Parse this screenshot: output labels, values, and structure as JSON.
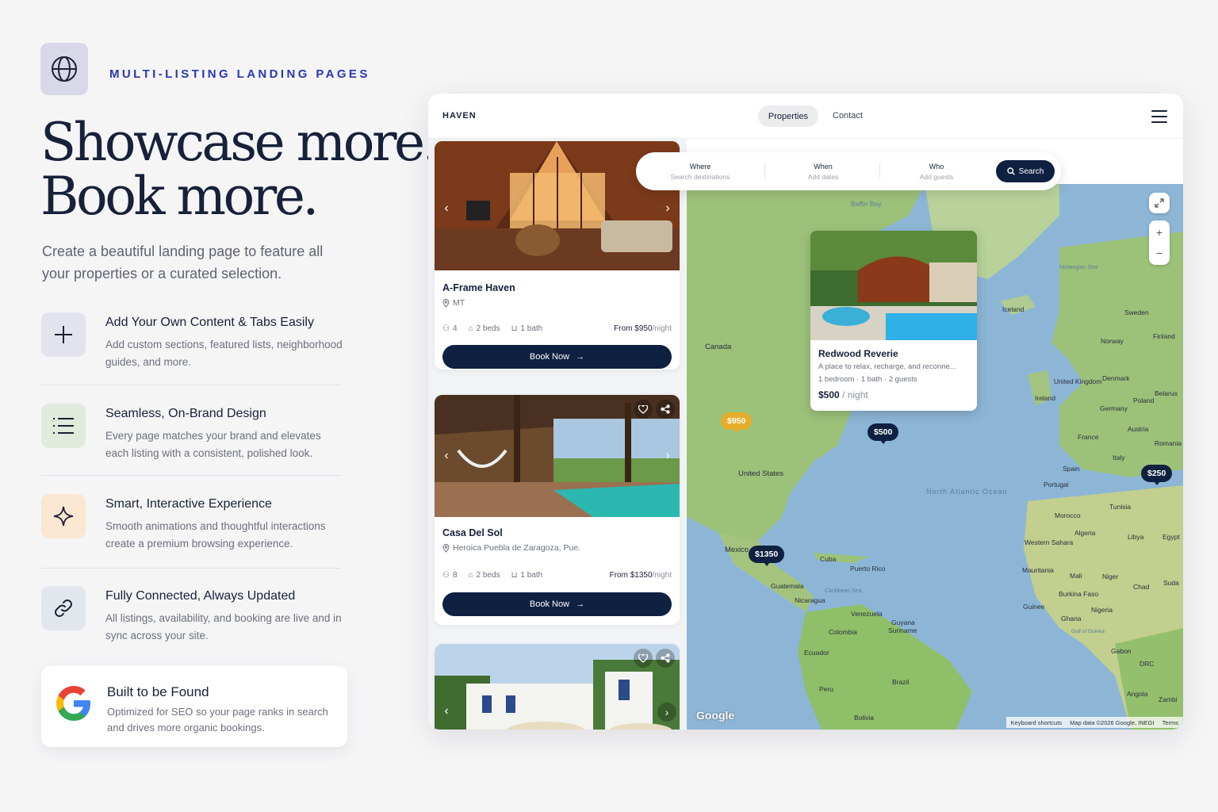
{
  "eyebrow": "MULTI-LISTING LANDING PAGES",
  "headline": {
    "line1": "Showcase more.",
    "line2": "Book more."
  },
  "subhead": "Create a beautiful landing page to feature all your properties or a curated selection.",
  "features": [
    {
      "title": "Add Your Own Content & Tabs Easily",
      "desc": "Add custom sections, featured lists, neighborhood guides, and more.",
      "icon": "plus-icon",
      "color": "#e3e3ee"
    },
    {
      "title": "Seamless, On-Brand Design",
      "desc": "Every page matches your brand and elevates each listing with a consistent, polished look.",
      "icon": "list-icon",
      "color": "#e2e9dd"
    },
    {
      "title": "Smart, Interactive Experience",
      "desc": "Smooth animations and thoughtful interactions create a premium browsing experience.",
      "icon": "sparkle-icon",
      "color": "#fbe7d2"
    },
    {
      "title": "Fully Connected, Always Updated",
      "desc": "All listings, availability, and booking are live and in sync across your site.",
      "icon": "link-icon",
      "color": "#e2e7ee"
    }
  ],
  "found": {
    "title": "Built to be Found",
    "desc": "Optimized for SEO so your page ranks in search and drives more organic bookings."
  },
  "app": {
    "brand": "HAVEN",
    "nav": {
      "properties": "Properties",
      "contact": "Contact"
    },
    "search": {
      "where_label": "Where",
      "where_placeholder": "Search destinations",
      "when_label": "When",
      "when_placeholder": "Add dates",
      "who_label": "Who",
      "who_placeholder": "Add guests",
      "button": "Search"
    },
    "listings": [
      {
        "title": "A-Frame Haven",
        "location": "MT",
        "guests": "4",
        "beds": "2 beds",
        "baths": "1 bath",
        "price": "From $950",
        "per": "/night",
        "cta": "Book Now"
      },
      {
        "title": "Casa Del Sol",
        "location": "Heroica Puebla de Zaragoza, Pue.",
        "guests": "8",
        "beds": "2 beds",
        "baths": "1 bath",
        "price": "From $1350",
        "per": "/night",
        "cta": "Book Now"
      }
    ],
    "map": {
      "popup": {
        "title": "Redwood Reverie",
        "desc": "A place to relax, recharge, and reconne...",
        "specs": "1 bedroom · 1 bath · 2 guests",
        "price": "$500",
        "per": " / night"
      },
      "pins": [
        "$950",
        "$500",
        "$1350",
        "$250"
      ],
      "labels": {
        "canada": "Canada",
        "us": "United States",
        "mexico": "Mexico",
        "cuba": "Cuba",
        "pr": "Puerto Rico",
        "guatemala": "Guatemala",
        "nicaragua": "Nicaragua",
        "venezuela": "Venezuela",
        "guyana": "Guyana",
        "suriname": "Suriname",
        "colombia": "Colombia",
        "ecuador": "Ecuador",
        "peru": "Peru",
        "brazil": "Brazil",
        "bolivia": "Bolivia",
        "iceland": "Iceland",
        "ireland": "Ireland",
        "uk": "United Kingdom",
        "sweden": "Sweden",
        "norway": "Norway",
        "finland": "Finland",
        "denmark": "Denmark",
        "belarus": "Belarus",
        "poland": "Poland",
        "germany": "Germany",
        "austria": "Austria",
        "france": "France",
        "romania": "Romania",
        "italy": "Italy",
        "spain": "Spain",
        "portugal": "Portugal",
        "tunisia": "Tunisia",
        "morocco": "Morocco",
        "algeria": "Algeria",
        "libya": "Libya",
        "egypt": "Egypt",
        "wsahara": "Western Sahara",
        "mauritania": "Mauritania",
        "mali": "Mali",
        "niger": "Niger",
        "chad": "Chad",
        "sudan": "Suda",
        "burkina": "Burkina Faso",
        "guinee": "Guinee",
        "nigeria": "Nigeria",
        "ghana": "Ghana",
        "gabon": "Gabon",
        "drc": "DRC",
        "angola": "Angola",
        "zambia": "Zambi",
        "ocean": "North Atlantic Ocean",
        "baffin": "Baffin Bay",
        "norwegian": "Norwegian Sea",
        "caribbean": "Caribbean Sea",
        "guinea_gulf": "Gulf of Guinea"
      },
      "google": "Google",
      "attribution": {
        "shortcuts": "Keyboard shortcuts",
        "data": "Map data ©2026 Google, INEGI",
        "terms": "Terms"
      }
    }
  },
  "colors": {
    "navy": "#0f2141",
    "accent_blue": "#2a36b8",
    "gold": "#e6ad2a"
  }
}
